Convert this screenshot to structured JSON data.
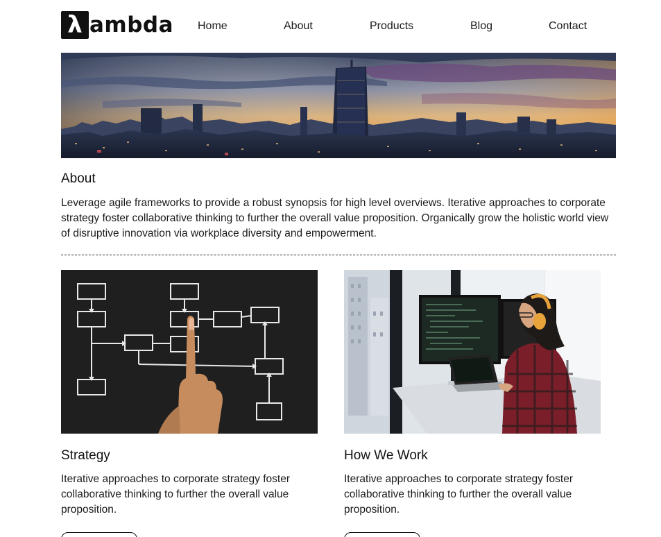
{
  "header": {
    "logo_text": "ambda",
    "logo_symbol": "λ",
    "nav": [
      "Home",
      "About",
      "Products",
      "Blog",
      "Contact"
    ]
  },
  "hero": {
    "icon": "city-skyline-image"
  },
  "about": {
    "title": "About",
    "text": "Leverage agile frameworks to provide a robust synopsis for high level overviews. Iterative approaches to corporate strategy foster collaborative thinking to further the overall value proposition. Organically grow the holistic world view of disruptive innovation via workplace diversity and empowerment."
  },
  "cards": [
    {
      "title": "Strategy",
      "text": "Iterative approaches to corporate strategy foster collaborative thinking to further the overall value proposition.",
      "image": "flowchart-chalkboard-image",
      "button": ""
    },
    {
      "title": "How We Work",
      "text": "Iterative approaches to corporate strategy foster collaborative thinking to further the overall value proposition.",
      "image": "developer-at-desk-image",
      "button": ""
    }
  ]
}
